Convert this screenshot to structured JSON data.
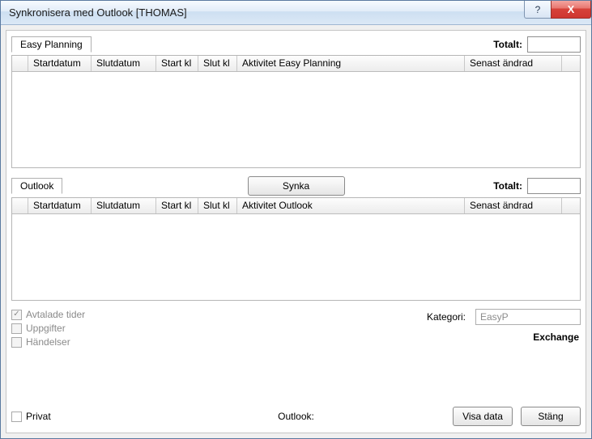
{
  "titlebar": {
    "title": "Synkronisera med Outlook [THOMAS]",
    "help_glyph": "?",
    "close_glyph": "X"
  },
  "section_ep": {
    "tab_label": "Easy Planning",
    "totalt_label": "Totalt:",
    "totalt_value": "",
    "columns": {
      "start": "Startdatum",
      "slut": "Slutdatum",
      "startkl": "Start kl",
      "slutkl": "Slut kl",
      "aktivitet": "Aktivitet Easy Planning",
      "senast": "Senast ändrad"
    }
  },
  "synka_label": "Synka",
  "section_ol": {
    "tab_label": "Outlook",
    "totalt_label": "Totalt:",
    "totalt_value": "",
    "columns": {
      "start": "Startdatum",
      "slut": "Slutdatum",
      "startkl": "Start kl",
      "slutkl": "Slut kl",
      "aktivitet": "Aktivitet Outlook",
      "senast": "Senast ändrad"
    }
  },
  "checks": {
    "avtalade": {
      "label": "Avtalade tider",
      "checked": true
    },
    "uppgifter": {
      "label": "Uppgifter",
      "checked": false
    },
    "handelser": {
      "label": "Händelser",
      "checked": false
    }
  },
  "kategori": {
    "label": "Kategori:",
    "value": "EasyP"
  },
  "exchange_label": "Exchange",
  "footer": {
    "privat_label": "Privat",
    "outlook_label": "Outlook:",
    "visa_data": "Visa data",
    "stang": "Stäng"
  }
}
